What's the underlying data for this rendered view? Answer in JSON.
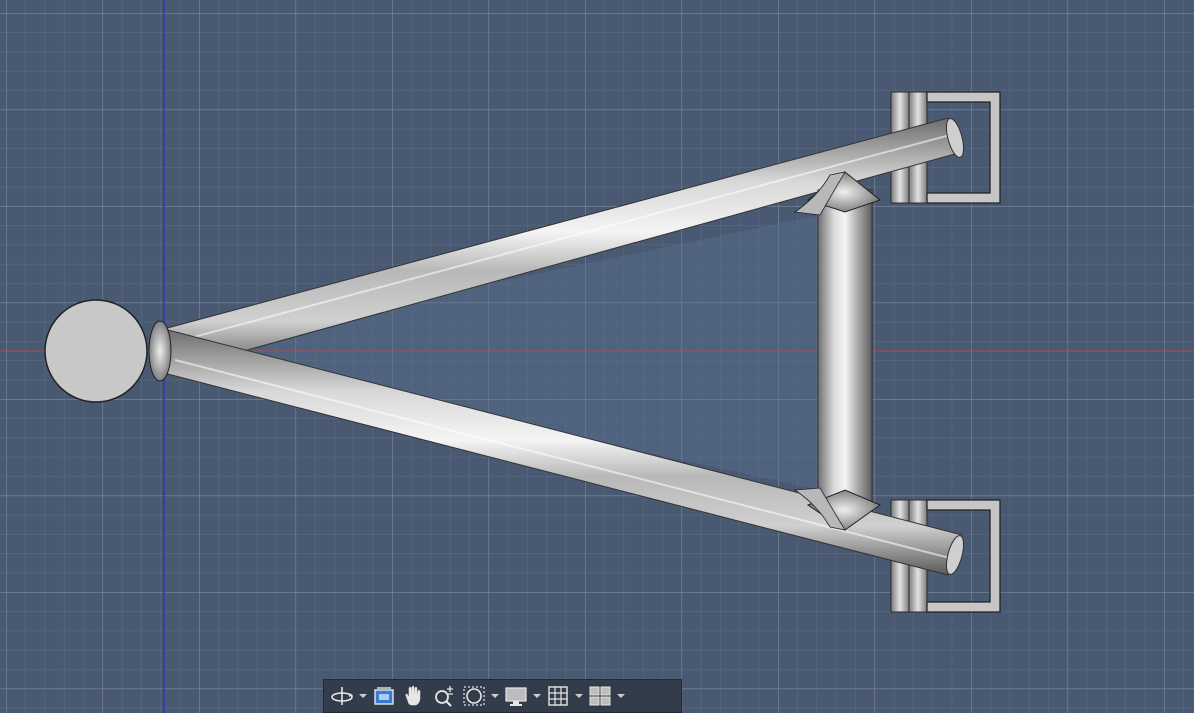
{
  "viewport": {
    "background": "#4a5972",
    "grid_minor_color": "#5f6d84",
    "grid_major_color": "#7a869a",
    "x_axis_color": "#b04848",
    "y_axis_color": "#2a34b8",
    "model_color": "#c2c2c2"
  },
  "model": {
    "description_name": "a-arm-control-arm",
    "parts": [
      "ball-joint",
      "upper-tube",
      "lower-tube",
      "cross-brace",
      "upper-bushing-bracket",
      "lower-bushing-bracket"
    ]
  },
  "toolbar": {
    "items": [
      {
        "name": "orbit-icon",
        "has_dropdown": true
      },
      {
        "name": "look-at-icon",
        "has_dropdown": false
      },
      {
        "name": "pan-icon",
        "has_dropdown": false
      },
      {
        "name": "zoom-icon",
        "has_dropdown": false
      },
      {
        "name": "fit-window-icon",
        "has_dropdown": true
      },
      {
        "name": "display-settings-icon",
        "has_dropdown": true
      },
      {
        "name": "grid-settings-icon",
        "has_dropdown": true
      },
      {
        "name": "viewports-icon",
        "has_dropdown": true
      }
    ]
  }
}
